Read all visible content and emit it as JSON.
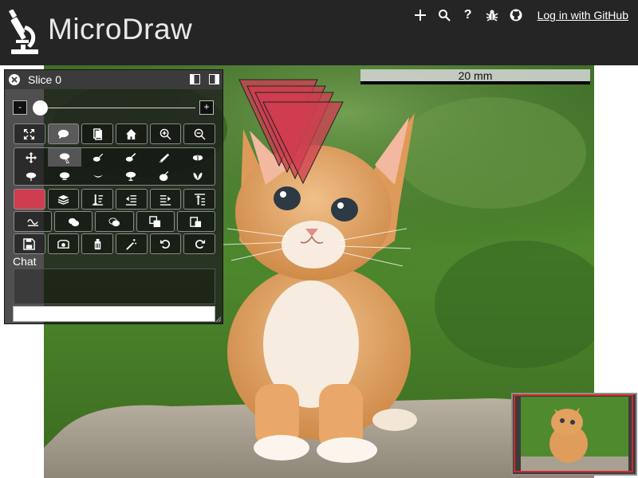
{
  "app": {
    "title": "MicroDraw",
    "login_label": "Log in with GitHub"
  },
  "header_icons": [
    "add-icon",
    "search-icon",
    "help-icon",
    "bug-icon",
    "github-icon"
  ],
  "header_glyphs": {
    "help": "?"
  },
  "panel": {
    "slice_label": "Slice 0",
    "slider": {
      "minus_label": "-",
      "plus_label": "+",
      "value": 0
    },
    "chat_label": "Chat",
    "chat_input_value": ""
  },
  "viewer": {
    "scale_label": "20 mm"
  },
  "colors": {
    "header_bg": "#252525",
    "annotation_fill": "#d03c50",
    "panel_bg": "#1e1e1e"
  },
  "toolbar_rows": [
    [
      "fullscreen-icon",
      "comment-icon",
      "notes-icon",
      "home-icon",
      "zoom-in-icon",
      "zoom-out-icon"
    ],
    [
      "move-icon",
      "select-icon",
      "draw-icon",
      "draw-polygon-icon",
      "simplify-icon",
      "add-point-icon",
      "delete-point-icon",
      "add-region-icon",
      "subtract-region-icon",
      "split-icon",
      "flip-icon",
      "snap-icon"
    ],
    [
      "color-swatch",
      "order-layers-icon",
      "sort-down-icon",
      "indent-icon",
      "outdent-icon",
      "to-top-icon"
    ],
    [
      "smooth-icon",
      "union-icon",
      "intersect-icon",
      "copy-icon",
      "paste-icon"
    ],
    [
      "save-icon",
      "screenshot-icon",
      "clear-icon",
      "magic-wand-icon",
      "undo-icon",
      "redo-icon"
    ]
  ]
}
